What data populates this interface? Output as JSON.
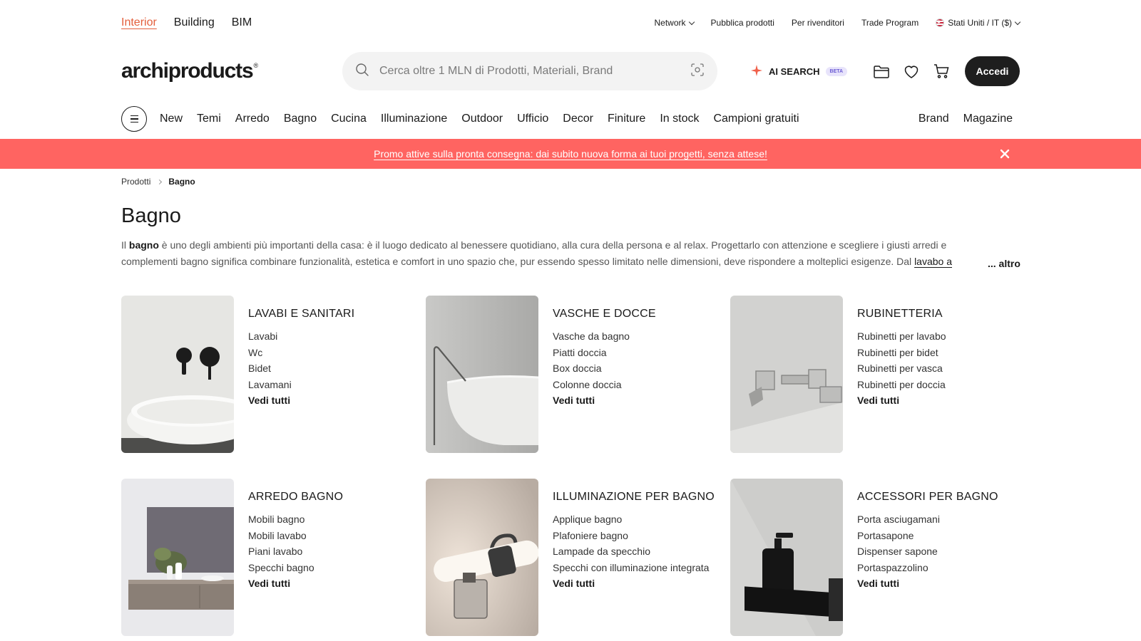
{
  "top": {
    "segments": [
      "Interior",
      "Building",
      "BIM"
    ],
    "network": "Network",
    "publish": "Pubblica prodotti",
    "resellers": "Per rivenditori",
    "trade": "Trade Program",
    "locale": "Stati Uniti / IT ($)"
  },
  "header": {
    "logo": "archiproducts",
    "logo_mark": "®",
    "search_placeholder": "Cerca oltre 1 MLN di Prodotti, Materiali, Brand",
    "ai_label": "AI SEARCH",
    "beta": "BETA",
    "login": "Accedi"
  },
  "nav": {
    "items": [
      "New",
      "Temi",
      "Arredo",
      "Bagno",
      "Cucina",
      "Illuminazione",
      "Outdoor",
      "Ufficio",
      "Decor",
      "Finiture",
      "In stock",
      "Campioni gratuiti"
    ],
    "right": [
      "Brand",
      "Magazine"
    ]
  },
  "promo": {
    "text": "Promo attive sulla pronta consegna: dai subito nuova forma ai tuoi progetti, senza attese!"
  },
  "breadcrumb": [
    "Prodotti",
    "Bagno"
  ],
  "page": {
    "title": "Bagno",
    "intro_1": "Il ",
    "intro_bold": "bagno",
    "intro_2": " è uno degli ambienti più importanti della casa: è il luogo dedicato al benessere quotidiano, alla cura della persona e al relax. Progettarlo con attenzione e scegliere i giusti arredi e complementi bagno significa combinare funzionalità, estetica e comfort in uno spazio che, pur essendo spesso limitato nelle dimensioni, deve rispondere a molteplici esigenze. Dal ",
    "intro_link": "lavabo a",
    "more": "... altro"
  },
  "categories": [
    {
      "title": "LAVABI E SANITARI",
      "items": [
        "Lavabi",
        "Wc",
        "Bidet",
        "Lavamani"
      ],
      "all": "Vedi tutti"
    },
    {
      "title": "VASCHE E DOCCE",
      "items": [
        "Vasche da bagno",
        "Piatti doccia",
        "Box doccia",
        "Colonne doccia"
      ],
      "all": "Vedi tutti"
    },
    {
      "title": "RUBINETTERIA",
      "items": [
        "Rubinetti per lavabo",
        "Rubinetti per bidet",
        "Rubinetti per vasca",
        "Rubinetti per doccia"
      ],
      "all": "Vedi tutti"
    },
    {
      "title": "ARREDO BAGNO",
      "items": [
        "Mobili bagno",
        "Mobili lavabo",
        "Piani lavabo",
        "Specchi bagno"
      ],
      "all": "Vedi tutti"
    },
    {
      "title": "ILLUMINAZIONE PER BAGNO",
      "items": [
        "Applique bagno",
        "Plafoniere bagno",
        "Lampade da specchio",
        "Specchi con illuminazione integrata"
      ],
      "all": "Vedi tutti"
    },
    {
      "title": "ACCESSORI PER BAGNO",
      "items": [
        "Porta asciugamani",
        "Portasapone",
        "Dispenser sapone",
        "Portaspazzolino"
      ],
      "all": "Vedi tutti"
    }
  ],
  "colors": {
    "accent": "#e35f3c",
    "promo_bg": "#ff6461",
    "button_dark": "#1e1e1e"
  }
}
